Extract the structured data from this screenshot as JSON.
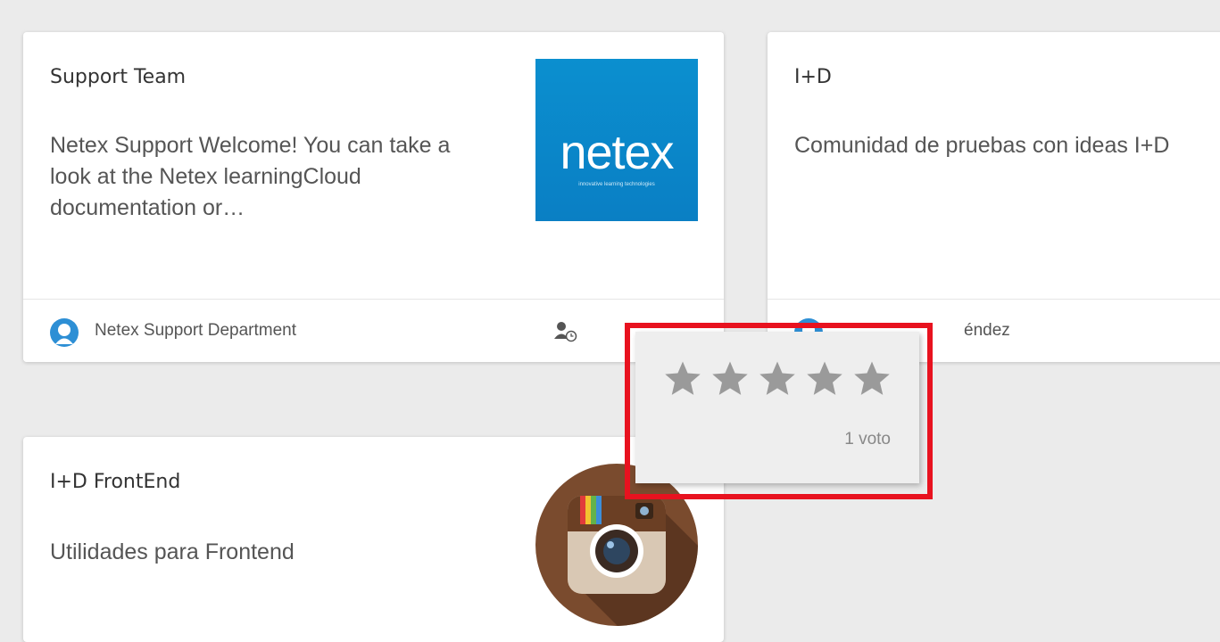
{
  "cards": [
    {
      "title": "Support Team",
      "description": "Netex Support Welcome! You can take a look at the Netex learningCloud documentation or…",
      "owner": "Netex Support Department",
      "logo_word": "netex",
      "logo_tagline": "innovative learning technologies"
    },
    {
      "title": "I+D",
      "description": "Comunidad de pruebas con ideas I+D",
      "owner_visible": "éndez"
    },
    {
      "title": "I+D FrontEnd",
      "description": "Utilidades para Frontend"
    }
  ],
  "rating_popup": {
    "star_count": 5,
    "votes_label": "1 voto"
  },
  "colors": {
    "background": "#ebebeb",
    "card": "#ffffff",
    "netex_blue": "#0a86c8",
    "star_gray": "#9a9a9a",
    "highlight_red": "#e8121f",
    "instagram_brown": "#7a4b2e"
  },
  "icons": {
    "owner_avatar": "user-avatar-icon",
    "members": "member-clock-icon",
    "star": "star-icon"
  }
}
